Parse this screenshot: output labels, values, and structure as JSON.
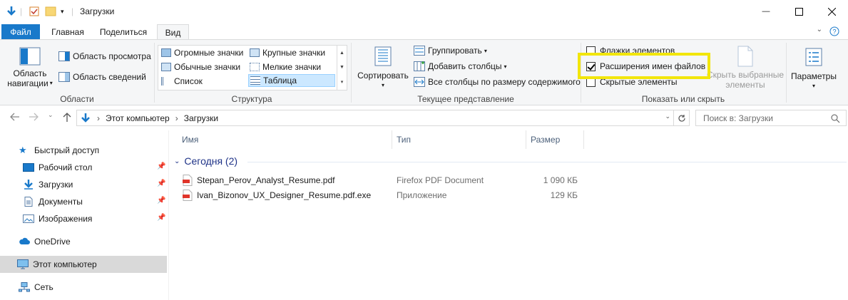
{
  "window": {
    "title": "Загрузки",
    "minimize_glyph": "—",
    "maximize_glyph": "☐",
    "close_glyph": "✕"
  },
  "ribbon_tabs": {
    "file": "Файл",
    "home": "Главная",
    "share": "Поделиться",
    "view": "Вид"
  },
  "panes_group": {
    "nav_pane_line1": "Область",
    "nav_pane_line2": "навигации",
    "preview_pane": "Область просмотра",
    "details_pane": "Область сведений",
    "label": "Области"
  },
  "layout_group": {
    "extra_large_icons": "Огромные значки",
    "large_icons": "Крупные значки",
    "medium_icons": "Обычные значки",
    "small_icons": "Мелкие значки",
    "list": "Список",
    "details": "Таблица",
    "label": "Структура"
  },
  "current_view_group": {
    "sort_by": "Сортировать",
    "group_by": "Группировать",
    "add_columns": "Добавить столбцы",
    "size_all_columns": "Все столбцы по размеру содержимого",
    "label": "Текущее представление"
  },
  "show_hide_group": {
    "item_checkboxes": "Флажки элементов",
    "file_name_extensions": "Расширения имен файлов",
    "hidden_items": "Скрытые элементы",
    "hide_selected_line1": "Скрыть выбранные",
    "hide_selected_line2": "элементы",
    "label": "Показать или скрыть",
    "item_checkboxes_checked": false,
    "file_name_extensions_checked": true,
    "hidden_items_checked": false
  },
  "options": {
    "label": "Параметры"
  },
  "address_bar": {
    "crumb1": "Этот компьютер",
    "crumb2": "Загрузки",
    "search_placeholder": "Поиск в: Загрузки"
  },
  "nav_pane": {
    "quick_access": "Быстрый доступ",
    "desktop": "Рабочий стол",
    "downloads": "Загрузки",
    "documents": "Документы",
    "pictures": "Изображения",
    "onedrive": "OneDrive",
    "this_pc": "Этот компьютер",
    "network": "Сеть"
  },
  "file_list": {
    "col_name": "Имя",
    "col_type": "Тип",
    "col_size": "Размер",
    "group_title": "Сегодня (2)",
    "files": [
      {
        "name": "Stepan_Perov_Analyst_Resume.pdf",
        "type": "Firefox PDF Document",
        "size": "1 090 КБ"
      },
      {
        "name": "Ivan_Bizonov_UX_Designer_Resume.pdf.exe",
        "type": "Приложение",
        "size": "129 КБ"
      }
    ]
  },
  "colors": {
    "accent_blue": "#1979ca",
    "highlight_yellow": "#f2e60c",
    "selection_bg": "#cce8ff",
    "group_title": "#1e3287"
  }
}
